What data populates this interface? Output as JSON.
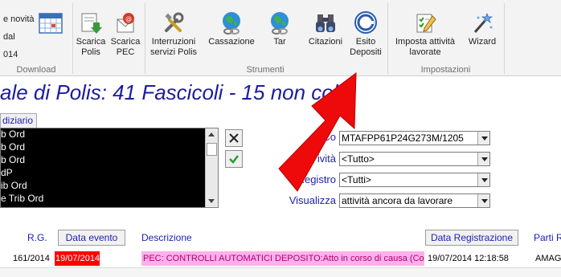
{
  "ribbon": {
    "left_items": [
      "e novità",
      "dal",
      "014"
    ],
    "groups": {
      "download": "Download",
      "strumenti": "Strumenti",
      "impostazioni": "Impostazioni"
    },
    "buttons": {
      "scarica_polis": "Scarica Polis",
      "scarica_pec": "Scarica PEC",
      "interruzioni": "Interruzioni servizi Polis",
      "cassazione": "Cassazione",
      "tar": "Tar",
      "citazioni": "Citazioni",
      "esito_depositi": "Esito Depositi",
      "imposta_attivita": "Imposta attività lavorate",
      "wizard": "Wizard"
    }
  },
  "title": "ale di Polis: 41 Fascicoli - 15 non colle",
  "courts": {
    "tab_label": "diziario",
    "items": [
      "b Ord",
      "b Ord",
      "b Ord",
      "dP",
      "ib Ord",
      "e Trib Ord"
    ]
  },
  "filters": {
    "contatto_label": "Co",
    "contatto_value": "MTAFPP61P24G273M/1205",
    "attivita_label": "ività",
    "attivita_value": "<Tutto>",
    "registro_label": "Registro",
    "registro_value": "<Tutti>",
    "visualizza_label": "Visualizza",
    "visualizza_value": "attività ancora da lavorare"
  },
  "table": {
    "headers": {
      "rg": "R.G.",
      "data_evento": "Data evento",
      "descrizione": "Descrizione",
      "data_registrazione": "Data Registrazione",
      "parti": "Parti R"
    },
    "rows": [
      {
        "rg": "161/2014",
        "data_evento": "19/07/2014",
        "descrizione": "PEC: CONTROLLI AUTOMATICI DEPOSITO:Atto in corso di causa (Conten",
        "data_registrazione": "19/07/2014 12:18:58",
        "parti": "AMAG"
      }
    ]
  },
  "colors": {
    "accent_blue": "#1c1c9e",
    "highlight_red": "#ff0000",
    "highlight_pink": "#ffb0ec",
    "arrow_red": "#ee0a0a"
  },
  "icons": [
    "calendar-grid-icon",
    "download-polis-icon",
    "pec-mail-icon",
    "tools-icon",
    "globe-chain-icon",
    "globe-chain-icon",
    "binoculars-icon",
    "giustizia-logo-icon",
    "checklist-pencil-icon",
    "magic-wand-icon"
  ]
}
